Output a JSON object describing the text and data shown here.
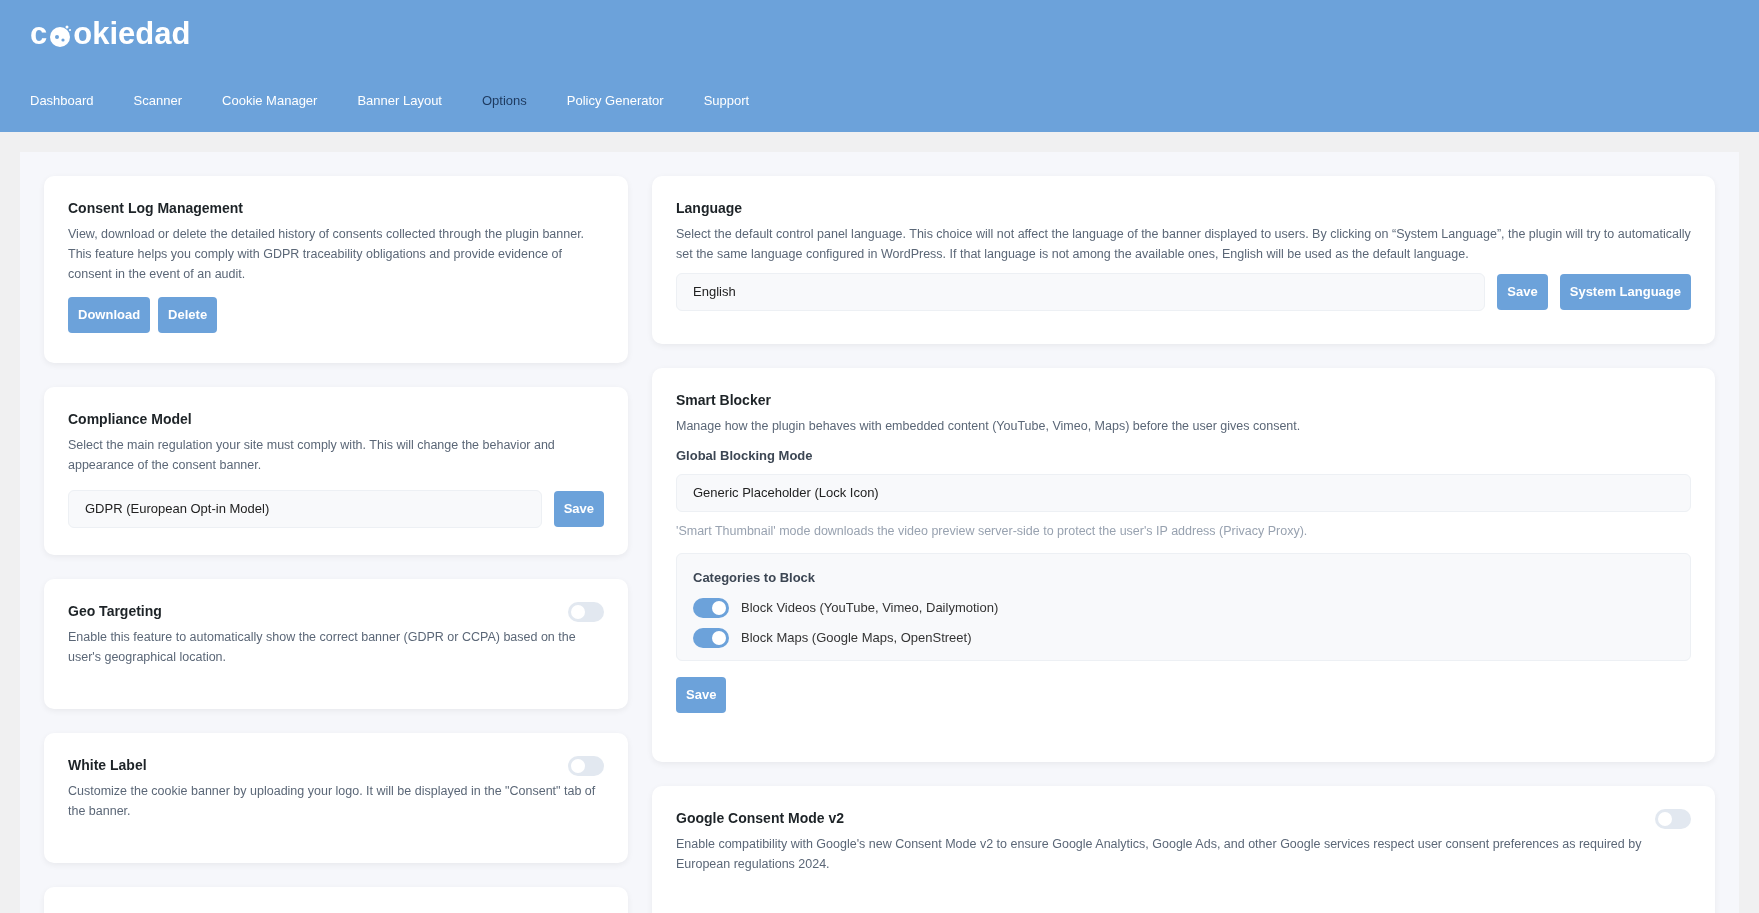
{
  "logo": {
    "first": "c",
    "rest": "okiedad"
  },
  "nav": [
    {
      "label": "Dashboard",
      "selected": false
    },
    {
      "label": "Scanner",
      "selected": false
    },
    {
      "label": "Cookie Manager",
      "selected": false
    },
    {
      "label": "Banner Layout",
      "selected": false
    },
    {
      "label": "Options",
      "selected": true
    },
    {
      "label": "Policy Generator",
      "selected": false
    },
    {
      "label": "Support",
      "selected": false
    }
  ],
  "left_cards": [
    {
      "kind": "buttons",
      "title": "Consent Log Management",
      "description": "View, download or delete the detailed history of consents collected through the plugin banner. This feature helps you comply with GDPR traceability obligations and provide evidence of consent in the event of an audit.",
      "buttons": [
        "Download",
        "Delete"
      ]
    },
    {
      "kind": "select",
      "title": "Compliance Model",
      "description": "Select the main regulation your site must comply with. This will change the behavior and appearance of the consent banner.",
      "value": "GDPR (European Opt-in Model)",
      "buttons": [
        "Save"
      ]
    },
    {
      "kind": "toggle",
      "title": "Geo Targeting",
      "description": "Enable this feature to automatically show the correct banner (GDPR or CCPA) based on the user's geographical location.",
      "on": false
    },
    {
      "kind": "toggle",
      "title": "White Label",
      "description": "Customize the cookie banner by uploading your logo. It will be displayed in the \"Consent\" tab of the banner.",
      "on": false
    }
  ],
  "language": {
    "title": "Language",
    "description": "Select the default control panel language. This choice will not affect the language of the banner displayed to users. By clicking on “System Language”, the plugin will try to automatically set the same language configured in WordPress. If that language is not among the available ones, English will be used as the default language.",
    "value": "English",
    "buttons": [
      "Save",
      "System Language"
    ]
  },
  "smart_blocker": {
    "title": "Smart Blocker",
    "description": "Manage how the plugin behaves with embedded content (YouTube, Vimeo, Maps) before the user gives consent.",
    "mode_label": "Global Blocking Mode",
    "mode_value": "Generic Placeholder (Lock Icon)",
    "hint": "'Smart Thumbnail' mode downloads the video preview server-side to protect the user's IP address (Privacy Proxy).",
    "categories_title": "Categories to Block",
    "categories": [
      {
        "label": "Block Videos (YouTube, Vimeo, Dailymotion)",
        "on": true
      },
      {
        "label": "Block Maps (Google Maps, OpenStreet)",
        "on": true
      }
    ],
    "button": "Save"
  },
  "consent_mode": {
    "title": "Google Consent Mode v2",
    "description": "Enable compatibility with Google's new Consent Mode v2 to ensure Google Analytics, Google Ads, and other Google services respect user consent preferences as required by European regulations 2024.",
    "on": false
  }
}
